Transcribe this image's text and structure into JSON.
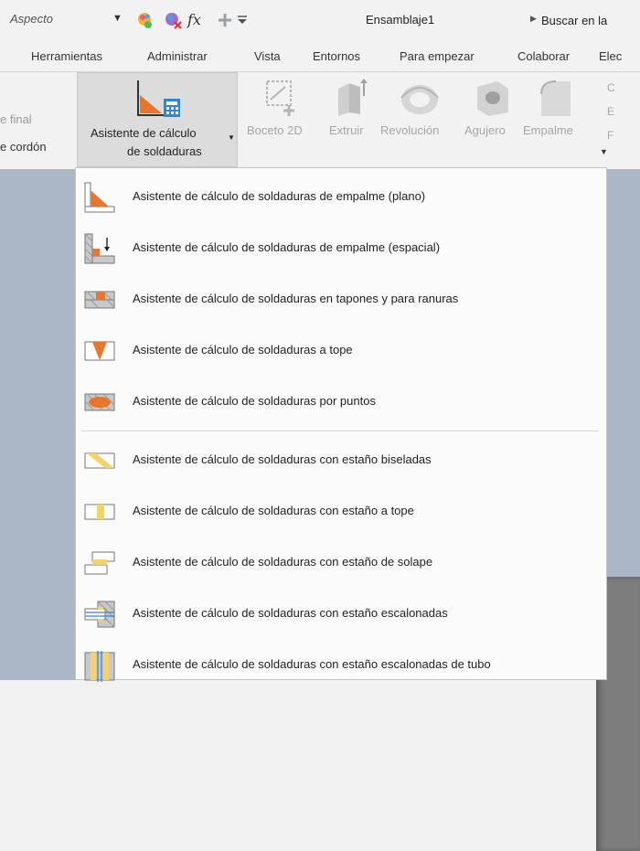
{
  "quick_access": {
    "appearance_label": "Aspecto",
    "document_title": "Ensamblaje1",
    "search_text": "Buscar en la"
  },
  "tabs": [
    {
      "label": "Herramientas"
    },
    {
      "label": "Administrar"
    },
    {
      "label": "Vista"
    },
    {
      "label": "Entornos"
    },
    {
      "label": "Para empezar"
    },
    {
      "label": "Colaborar"
    },
    {
      "label": "Elec"
    }
  ],
  "ribbon": {
    "left_top_label": "e final",
    "left_bottom_label": "e cordón",
    "weld_button": {
      "line1": "Asistente de cálculo",
      "line2": "de soldaduras"
    },
    "tools": [
      {
        "label": "Boceto 2D"
      },
      {
        "label": "Extruir"
      },
      {
        "label": "Revolución"
      },
      {
        "label": "Agujero"
      },
      {
        "label": "Empalme"
      }
    ],
    "right_small": [
      "C",
      "E",
      "F"
    ]
  },
  "menu": {
    "items": [
      {
        "label": "Asistente de cálculo de soldaduras de empalme (plano)",
        "icon": "fillet-weld-plane-icon"
      },
      {
        "label": "Asistente de cálculo de soldaduras de empalme (espacial)",
        "icon": "fillet-weld-spatial-icon"
      },
      {
        "label": "Asistente de cálculo de soldaduras en tapones y para ranuras",
        "icon": "plug-slot-weld-icon"
      },
      {
        "label": "Asistente de cálculo de soldaduras a tope",
        "icon": "butt-weld-icon"
      },
      {
        "label": "Asistente de cálculo de soldaduras por puntos",
        "icon": "spot-weld-icon"
      },
      {
        "label": "Asistente de cálculo de soldaduras con estaño biseladas",
        "icon": "bevel-solder-icon"
      },
      {
        "label": "Asistente de cálculo de soldaduras con estaño a tope",
        "icon": "butt-solder-icon"
      },
      {
        "label": "Asistente de cálculo de soldaduras con estaño de solape",
        "icon": "lap-solder-icon"
      },
      {
        "label": "Asistente de cálculo de soldaduras con estaño escalonadas",
        "icon": "stepped-solder-icon"
      },
      {
        "label": "Asistente de cálculo de soldaduras con estaño escalonadas de tubo",
        "icon": "tube-stepped-solder-icon"
      }
    ]
  },
  "colors": {
    "weld_orange": "#e8762c",
    "solder_yellow": "#f6d36a",
    "viewport_blue": "#aab7c7"
  }
}
